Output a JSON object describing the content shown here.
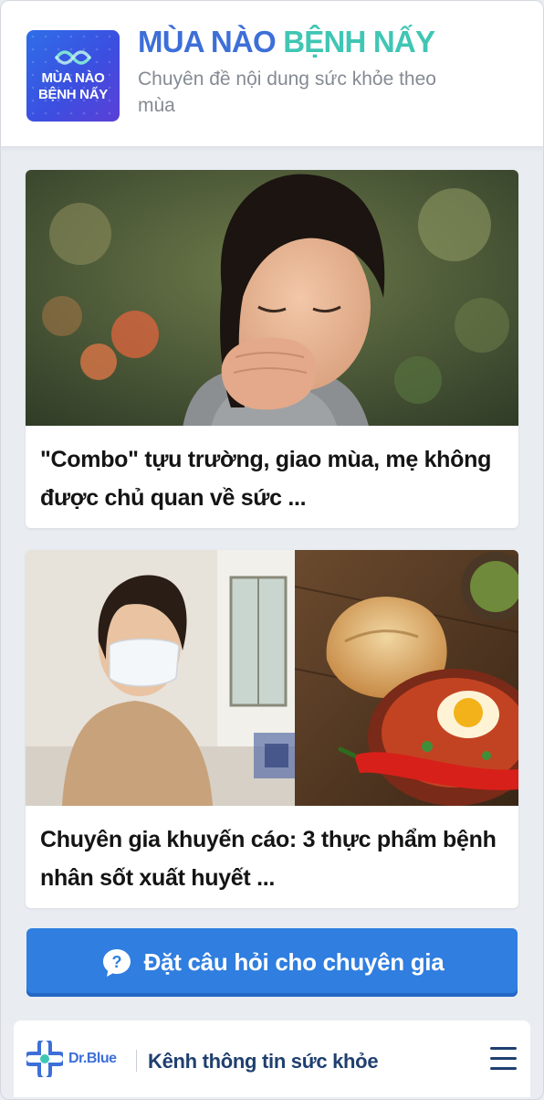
{
  "header": {
    "logo_line1": "MÙA NÀO",
    "logo_line2": "BỆNH NẤY",
    "title_part1": "MÙA NÀO",
    "title_part2": "BỆNH NẤY",
    "subtitle": "Chuyên đề nội dung sức khỏe theo mùa"
  },
  "articles": [
    {
      "title": "\"Combo\" tựu trường, giao mùa, mẹ không được chủ quan về sức ...",
      "image": "child-coughing-photo"
    },
    {
      "title": "Chuyên gia khuyến cáo: 3 thực phẩm bệnh nhân sốt xuất huyết ...",
      "image": "masked-woman-and-food-photo"
    }
  ],
  "cta": {
    "label": "Đặt câu hỏi cho chuyên gia",
    "icon": "question-icon"
  },
  "footer": {
    "brand": "Dr.Blue",
    "tagline": "Kênh thông tin sức khỏe",
    "menu_icon": "hamburger-menu-icon"
  },
  "colors": {
    "brand_blue": "#3d6fd8",
    "brand_teal": "#3fc6b4",
    "cta_blue": "#2f7ee0",
    "footer_navy": "#1f3f6f",
    "page_bg": "#e9edf2"
  }
}
